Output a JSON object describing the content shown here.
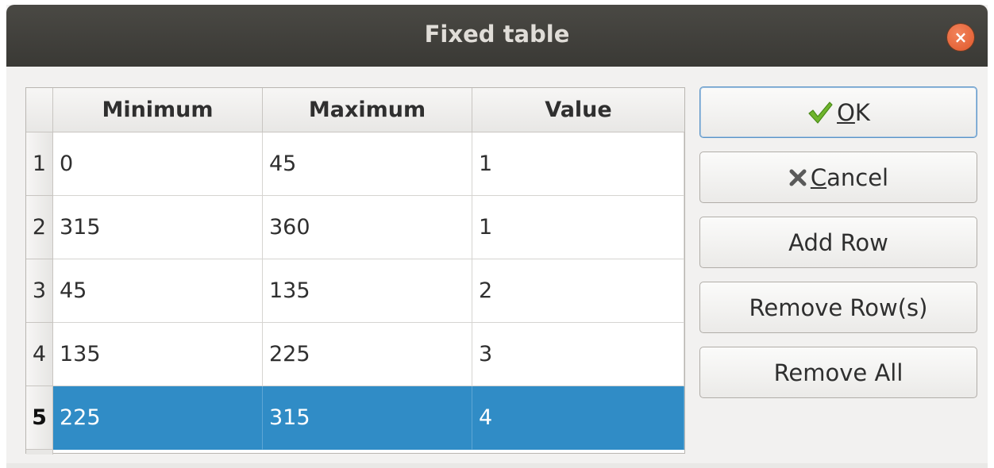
{
  "window": {
    "title": "Fixed table",
    "close_glyph": "×"
  },
  "table": {
    "columns": [
      "Minimum",
      "Maximum",
      "Value"
    ],
    "rows": [
      {
        "num": "1",
        "cells": [
          "0",
          "45",
          "1"
        ]
      },
      {
        "num": "2",
        "cells": [
          "315",
          "360",
          "1"
        ]
      },
      {
        "num": "3",
        "cells": [
          "45",
          "135",
          "2"
        ]
      },
      {
        "num": "4",
        "cells": [
          "135",
          "225",
          "3"
        ]
      },
      {
        "num": "5",
        "cells": [
          "225",
          "315",
          "4"
        ]
      }
    ],
    "selected_row": "5",
    "selection_color": "#308cc6"
  },
  "buttons": {
    "ok": {
      "mnemonic": "O",
      "rest": "K",
      "icon": "checkmark-icon",
      "icon_color": "#6fb52c"
    },
    "cancel": {
      "mnemonic": "C",
      "rest": "ancel",
      "icon": "x-icon"
    },
    "add_row": "Add Row",
    "remove_rows": "Remove Row(s)",
    "remove_all": "Remove All"
  }
}
